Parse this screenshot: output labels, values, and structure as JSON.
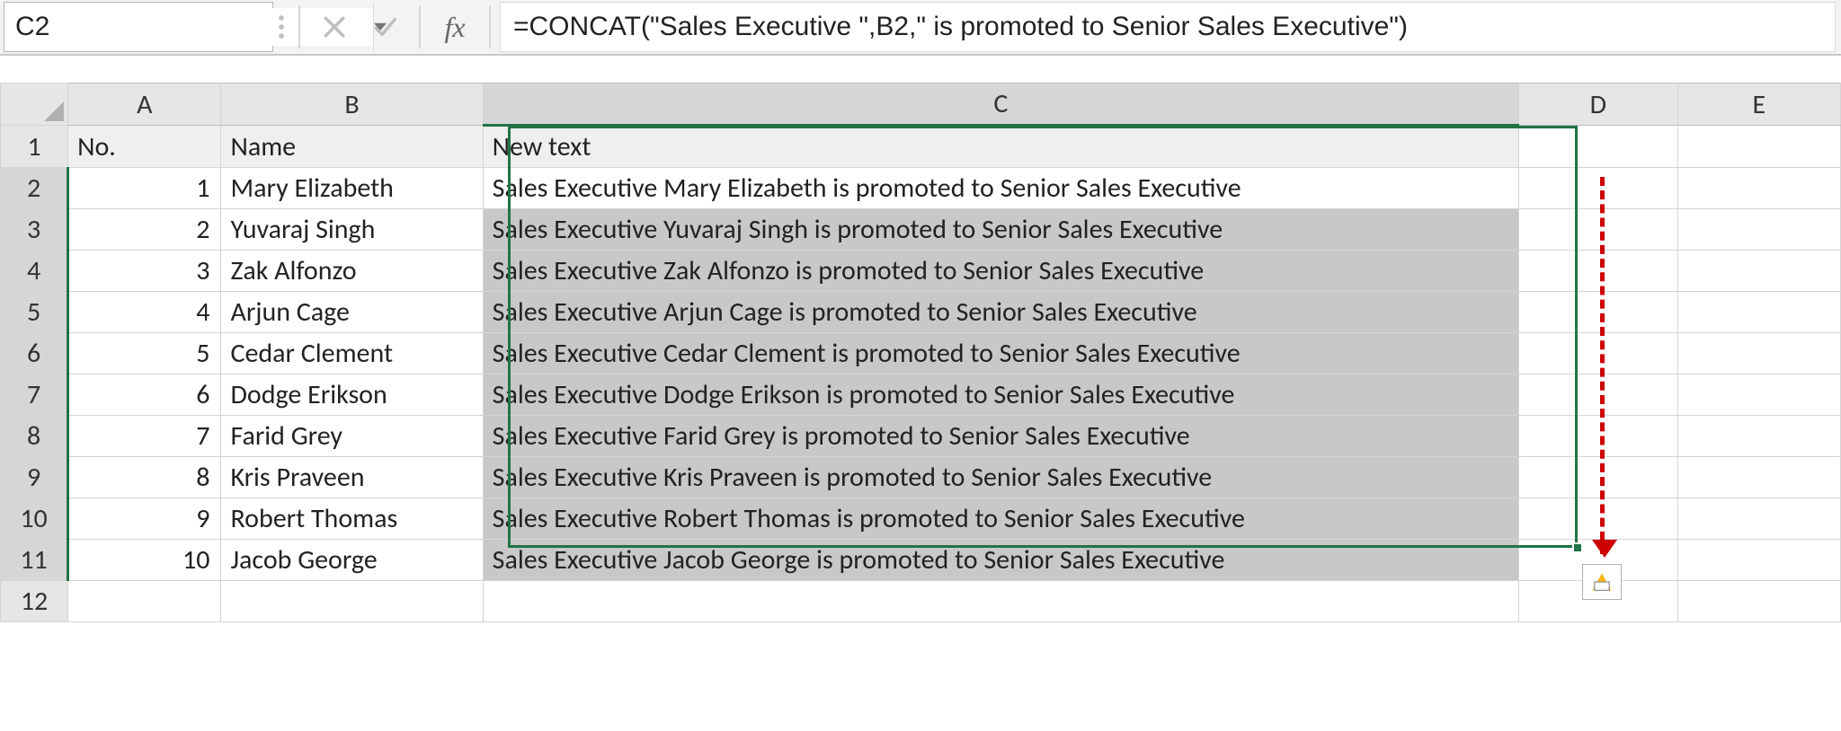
{
  "name_box": {
    "value": "C2"
  },
  "formula_bar": {
    "fx_label": "fx",
    "formula": "=CONCAT(\"Sales Executive \",B2,\" is promoted to Senior Sales Executive\")"
  },
  "columns": [
    "A",
    "B",
    "C",
    "D",
    "E"
  ],
  "row_numbers": [
    "1",
    "2",
    "3",
    "4",
    "5",
    "6",
    "7",
    "8",
    "9",
    "10",
    "11",
    "12"
  ],
  "headers": {
    "A": "No.",
    "B": "Name",
    "C": "New text"
  },
  "rows": [
    {
      "no": "1",
      "name": "Mary Elizabeth",
      "text": "Sales Executive Mary Elizabeth is promoted to Senior Sales Executive"
    },
    {
      "no": "2",
      "name": "Yuvaraj Singh",
      "text": "Sales Executive Yuvaraj Singh is promoted to Senior Sales Executive"
    },
    {
      "no": "3",
      "name": "Zak Alfonzo",
      "text": "Sales Executive Zak Alfonzo is promoted to Senior Sales Executive"
    },
    {
      "no": "4",
      "name": "Arjun Cage",
      "text": "Sales Executive Arjun Cage is promoted to Senior Sales Executive"
    },
    {
      "no": "5",
      "name": "Cedar Clement",
      "text": "Sales Executive Cedar Clement is promoted to Senior Sales Executive"
    },
    {
      "no": "6",
      "name": "Dodge Erikson",
      "text": "Sales Executive Dodge Erikson is promoted to Senior Sales Executive"
    },
    {
      "no": "7",
      "name": "Farid Grey",
      "text": "Sales Executive Farid Grey is promoted to Senior Sales Executive"
    },
    {
      "no": "8",
      "name": "Kris Praveen",
      "text": "Sales Executive Kris Praveen is promoted to Senior Sales Executive"
    },
    {
      "no": "9",
      "name": "Robert Thomas",
      "text": "Sales Executive Robert Thomas is promoted to Senior Sales Executive"
    },
    {
      "no": "10",
      "name": "Jacob George",
      "text": "Sales Executive Jacob George is promoted to Senior Sales Executive"
    }
  ],
  "selection": {
    "active_cell": "C2",
    "range": "C2:C11",
    "selected_column": "C",
    "selected_rows_start": 2,
    "selected_rows_end": 11
  },
  "colors": {
    "accent": "#217346",
    "annotation": "#cc0000"
  }
}
